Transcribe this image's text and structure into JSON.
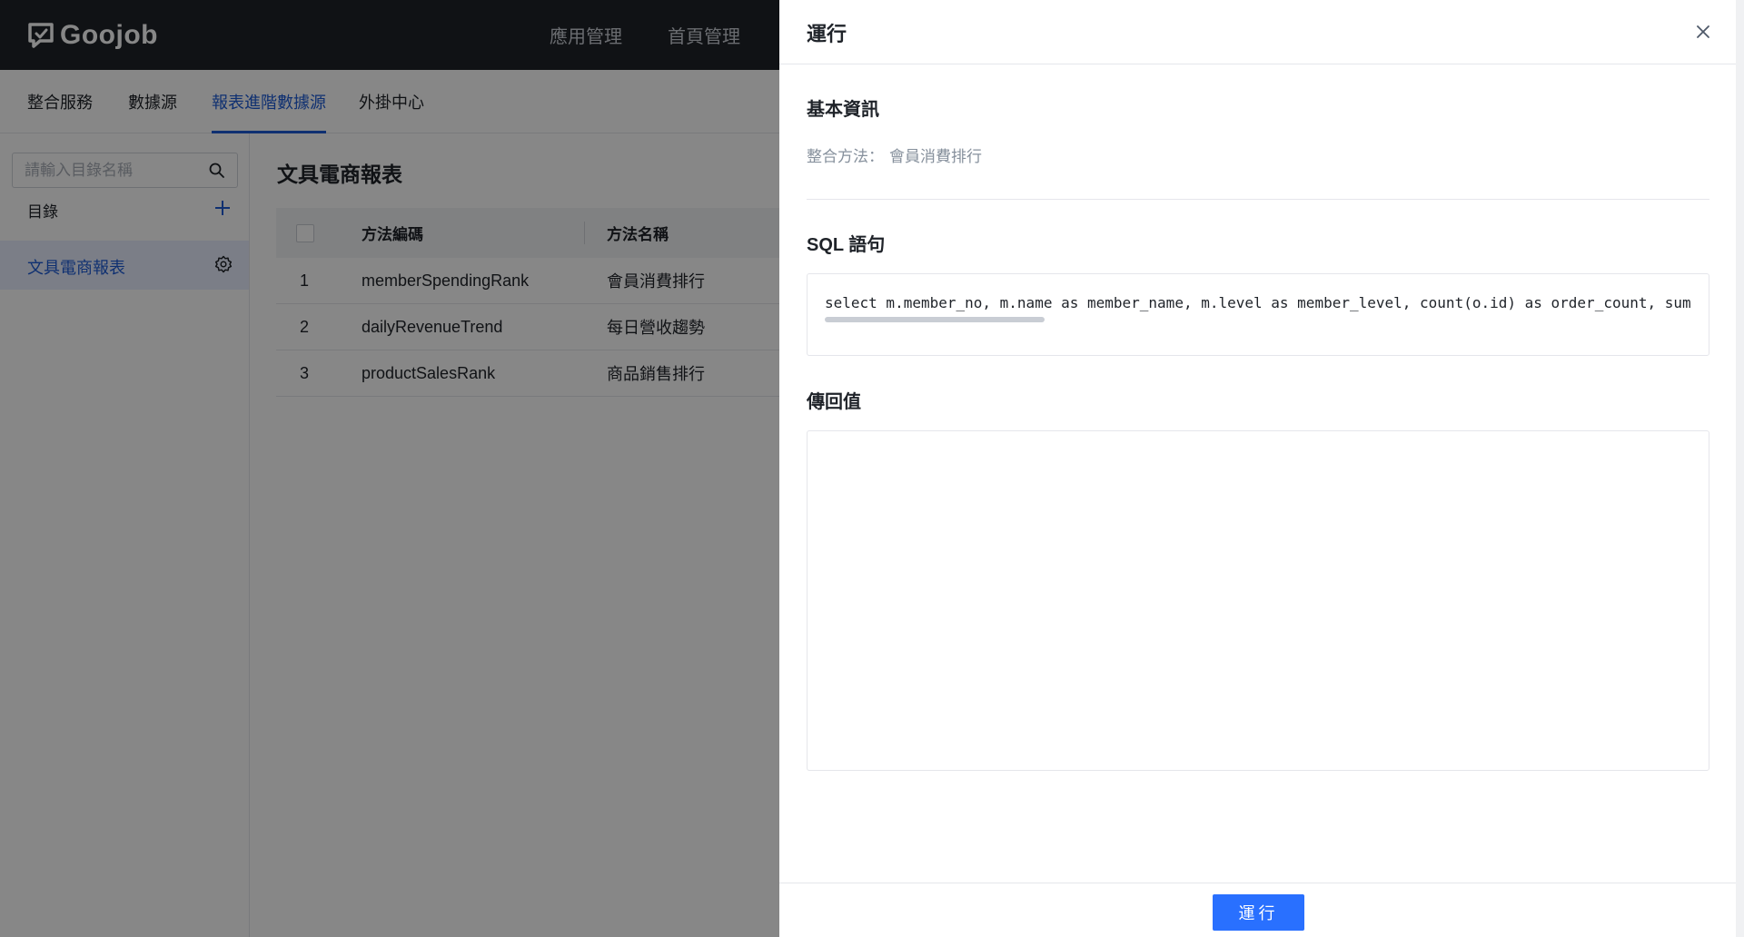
{
  "header": {
    "logo_text": "Goojob",
    "nav": [
      "應用管理",
      "首頁管理"
    ]
  },
  "subnav": {
    "tabs": [
      "整合服務",
      "數據源",
      "報表進階數據源",
      "外掛中心"
    ],
    "active": "報表進階數據源"
  },
  "sidebar": {
    "search_placeholder": "請輸入目錄名稱",
    "directory_title": "目錄",
    "items": [
      "文具電商報表"
    ]
  },
  "main": {
    "title": "文具電商報表",
    "table": {
      "columns": [
        "方法編碼",
        "方法名稱"
      ],
      "rows": [
        {
          "index": "1",
          "code": "memberSpendingRank",
          "name": "會員消費排行"
        },
        {
          "index": "2",
          "code": "dailyRevenueTrend",
          "name": "每日營收趨勢"
        },
        {
          "index": "3",
          "code": "productSalesRank",
          "name": "商品銷售排行"
        }
      ]
    }
  },
  "drawer": {
    "title": "運行",
    "basic_info_title": "基本資訊",
    "method_label": "整合方法：",
    "method_value": "會員消費排行",
    "sql_title": "SQL 語句",
    "sql_text": "select m.member_no, m.name as member_name, m.level as member_level, count(o.id) as order_count, sum",
    "return_title": "傳回值",
    "return_value": "",
    "run_label": "運行"
  },
  "colors": {
    "accent": "#2970ff",
    "active_text": "#1e5bd6",
    "header_bg": "#1f2329"
  }
}
